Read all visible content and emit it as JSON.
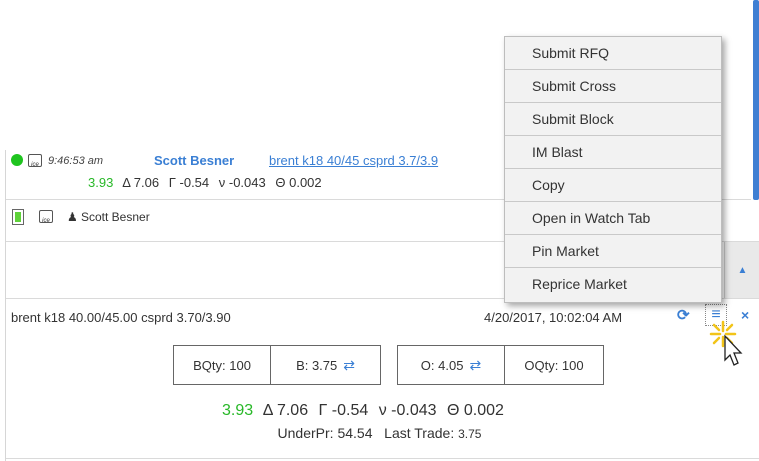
{
  "message": {
    "time": "9:46:53 am",
    "sender": "Scott Besner",
    "link_text": "brent k18 40/45 csprd 3.7/3.9",
    "price": "3.93",
    "delta": "Δ 7.06",
    "gamma": "Γ -0.54",
    "vega": "ν -0.043",
    "theta": "Θ 0.002",
    "ice_label": "ice"
  },
  "participant": {
    "name": "Scott Besner"
  },
  "market": {
    "title": "brent k18 40.00/45.00 csprd 3.70/3.90",
    "timestamp": "4/20/2017, 10:02:04 AM",
    "bid_qty": "BQty: 100",
    "bid": "B: 3.75",
    "offer": "O: 4.05",
    "offer_qty": "OQty: 100",
    "price": "3.93",
    "delta": "Δ 7.06",
    "gamma": "Γ -0.54",
    "vega": "ν -0.043",
    "theta": "Θ 0.002",
    "under_label": "UnderPr:",
    "under_value": "54.54",
    "last_trade_label": "Last Trade:",
    "last_trade_value": "3.75"
  },
  "context_menu": {
    "items": [
      "Submit RFQ",
      "Submit Cross",
      "Submit Block",
      "IM Blast",
      "Copy",
      "Open in Watch Tab",
      "Pin Market",
      "Reprice Market"
    ]
  },
  "icons": {
    "swap": "⇄",
    "refresh": "⟳",
    "menu": "≡",
    "close": "×",
    "up": "▲"
  },
  "colors": {
    "accent": "#3a7fd4",
    "online": "#1fc41f",
    "price_green": "#28b828"
  }
}
